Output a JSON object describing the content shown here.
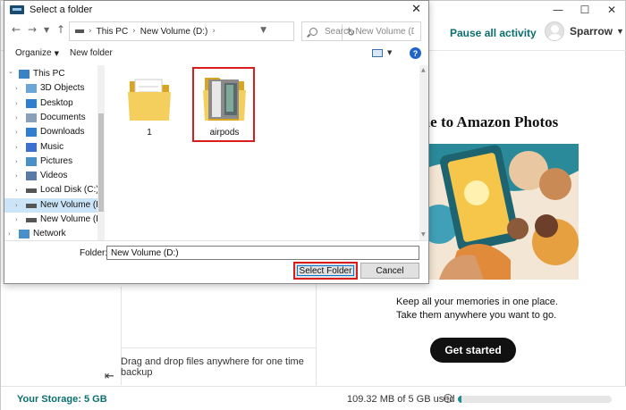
{
  "app": {
    "pause_label": "Pause all activity",
    "user_name": "Sparrow",
    "welcome": "me to Amazon Photos",
    "tagline_1": "Keep all your memories in one place.",
    "tagline_2": "Take them anywhere you want to go.",
    "get_started": "Get started",
    "drop_hint": "Drag and drop files anywhere for one time backup",
    "storage": "Your Storage: 5 GB",
    "usage": "109.32 MB of 5 GB used",
    "usage_fraction": 0.021,
    "accent_color": "#0d6e6e"
  },
  "dialog": {
    "title": "Select a folder",
    "breadcrumb": [
      "This PC",
      "New Volume (D:)"
    ],
    "search_placeholder": "Search New Volume (D:)",
    "toolbar": {
      "organize": "Organize",
      "new_folder": "New folder"
    },
    "nav_items": [
      {
        "label": "This PC",
        "icon": "computer-icon"
      },
      {
        "label": "3D Objects",
        "icon": "cube-icon"
      },
      {
        "label": "Desktop",
        "icon": "desktop-icon"
      },
      {
        "label": "Documents",
        "icon": "documents-icon"
      },
      {
        "label": "Downloads",
        "icon": "download-icon"
      },
      {
        "label": "Music",
        "icon": "music-icon"
      },
      {
        "label": "Pictures",
        "icon": "pictures-icon"
      },
      {
        "label": "Videos",
        "icon": "videos-icon"
      },
      {
        "label": "Local Disk (C:)",
        "icon": "drive-icon"
      },
      {
        "label": "New Volume (D:",
        "icon": "drive-icon",
        "selected": true
      },
      {
        "label": "New Volume (E:)",
        "icon": "drive-icon"
      },
      {
        "label": "Network",
        "icon": "network-icon"
      }
    ],
    "folders": [
      {
        "name": "1"
      },
      {
        "name": "airpods"
      }
    ],
    "folder_label": "Folder:",
    "folder_value": "New Volume (D:)",
    "select_button": "Select Folder",
    "cancel_button": "Cancel",
    "highlight_color": "#d91c1c"
  }
}
